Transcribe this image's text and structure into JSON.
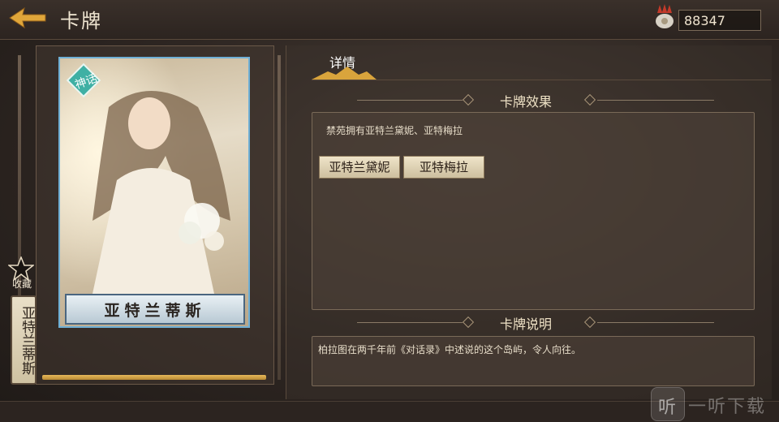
{
  "header": {
    "title": "卡牌",
    "back_icon": "back-arrow-icon"
  },
  "currency": {
    "icon": "feather-crest-icon",
    "value": "88347"
  },
  "collection": {
    "star_icon": "star-icon",
    "label": "收藏",
    "card_name_vertical": "亚特兰蒂斯"
  },
  "card": {
    "badge_icon": "myth-badge-icon",
    "badge_text": "神话",
    "name": "亚特兰蒂斯"
  },
  "tabs": [
    {
      "label": "详情",
      "active": true
    }
  ],
  "effect": {
    "heading": "卡牌效果",
    "text": "禁苑拥有亚特兰黛妮、亚特梅拉",
    "chips": [
      "亚特兰黛妮",
      "亚特梅拉"
    ]
  },
  "description": {
    "heading": "卡牌说明",
    "text": "柏拉图在两千年前《对话录》中述说的这个岛屿，令人向往。"
  },
  "watermark": {
    "icon": "ting-logo-icon",
    "glyph": "听",
    "text": "一听下载"
  },
  "colors": {
    "accent_gold": "#e6b85a",
    "card_border": "#6fb0d6",
    "chip_bg": "#efe4c9"
  }
}
